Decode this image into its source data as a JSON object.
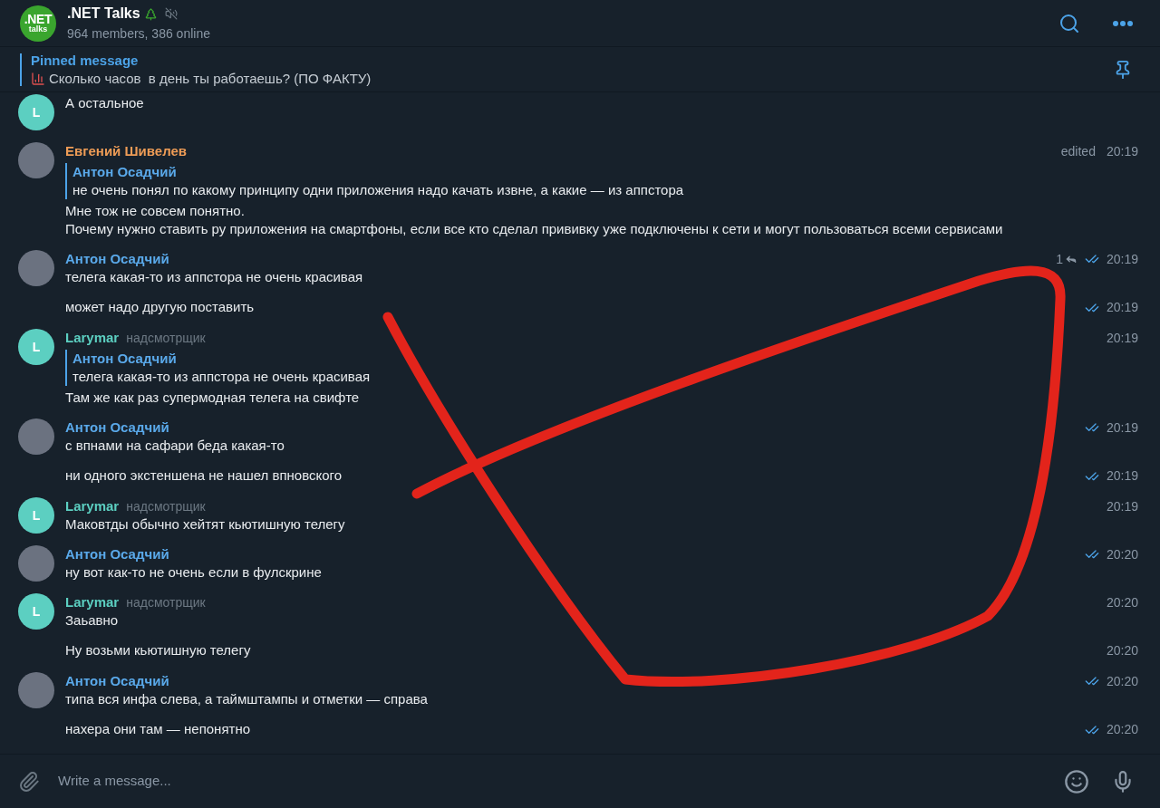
{
  "chat": {
    "logo": {
      "line1": ".NET",
      "line2": "talks"
    },
    "title": ".NET Talks",
    "muted": true,
    "subtitle": "964 members, 386 online"
  },
  "pinned": {
    "label": "Pinned message",
    "text": "Сколько часов  в день ты работаешь? (ПО ФАКТУ)"
  },
  "groups": [
    {
      "author": {
        "color": "#5ccfc1",
        "avatar": {
          "kind": "letter",
          "letter": "L"
        }
      },
      "messages": [
        {
          "text": "А остальное"
        }
      ]
    },
    {
      "author": {
        "name": "Евгений Шивелев",
        "color": "#ee9c56",
        "avatar": {
          "kind": "photo"
        }
      },
      "messages": [
        {
          "reply": {
            "author": "Антон Осадчий",
            "text": "не очень понял по какому принципу одни приложения надо качать извне, а какие — из аппстора"
          },
          "text": "Мне тож не совсем понятно.\nПочему нужно ставить ру приложения на смартфоны, если все кто сделал прививку уже подключены к сети и могут пользоваться всеми сервисами",
          "edited": "edited",
          "time": "20:19",
          "read": false
        }
      ]
    },
    {
      "author": {
        "name": "Антон Осадчий",
        "color": "#5aa9ea",
        "avatar": {
          "kind": "photo"
        }
      },
      "messages": [
        {
          "text": "телега какая-то из аппстора не очень красивая",
          "replies": "1",
          "time": "20:19",
          "read": true
        },
        {
          "text": "может надо другую поставить",
          "time": "20:19",
          "read": true
        }
      ]
    },
    {
      "author": {
        "name": "Larymar",
        "badge": "надсмотрщик",
        "color": "#5ccfc1",
        "avatar": {
          "kind": "letter",
          "letter": "L"
        }
      },
      "messages": [
        {
          "reply": {
            "author": "Антон Осадчий",
            "text": "телега какая-то из аппстора не очень красивая"
          },
          "text": "Там же как раз супермодная телега на свифте",
          "time": "20:19",
          "read": false
        }
      ]
    },
    {
      "author": {
        "name": "Антон Осадчий",
        "color": "#5aa9ea",
        "avatar": {
          "kind": "photo"
        }
      },
      "messages": [
        {
          "text": "с впнами на сафари беда какая-то",
          "time": "20:19",
          "read": true
        },
        {
          "text": "ни одного экстеншена не нашел впновского",
          "time": "20:19",
          "read": true
        }
      ]
    },
    {
      "author": {
        "name": "Larymar",
        "badge": "надсмотрщик",
        "color": "#5ccfc1",
        "avatar": {
          "kind": "letter",
          "letter": "L"
        }
      },
      "messages": [
        {
          "text": "Маковтды обычно хейтят кьютишную телегу",
          "time": "20:19",
          "read": false
        }
      ]
    },
    {
      "author": {
        "name": "Антон Осадчий",
        "color": "#5aa9ea",
        "avatar": {
          "kind": "photo"
        }
      },
      "messages": [
        {
          "text": "ну вот как-то не очень если в фулскрине",
          "time": "20:20",
          "read": true
        }
      ]
    },
    {
      "author": {
        "name": "Larymar",
        "badge": "надсмотрщик",
        "color": "#5ccfc1",
        "avatar": {
          "kind": "letter",
          "letter": "L"
        }
      },
      "messages": [
        {
          "text": "Заьавно",
          "time": "20:20",
          "read": false
        },
        {
          "text": "Ну возьми кьютишную телегу",
          "time": "20:20",
          "read": false
        }
      ]
    },
    {
      "author": {
        "name": "Антон Осадчий",
        "color": "#5aa9ea",
        "avatar": {
          "kind": "photo"
        }
      },
      "messages": [
        {
          "text": "типа вся инфа слева, а таймштампы и отметки — справа",
          "time": "20:20",
          "read": true
        },
        {
          "text": "нахера они там — непонятно",
          "time": "20:20",
          "read": true
        }
      ]
    }
  ],
  "composer": {
    "placeholder": "Write a message..."
  }
}
